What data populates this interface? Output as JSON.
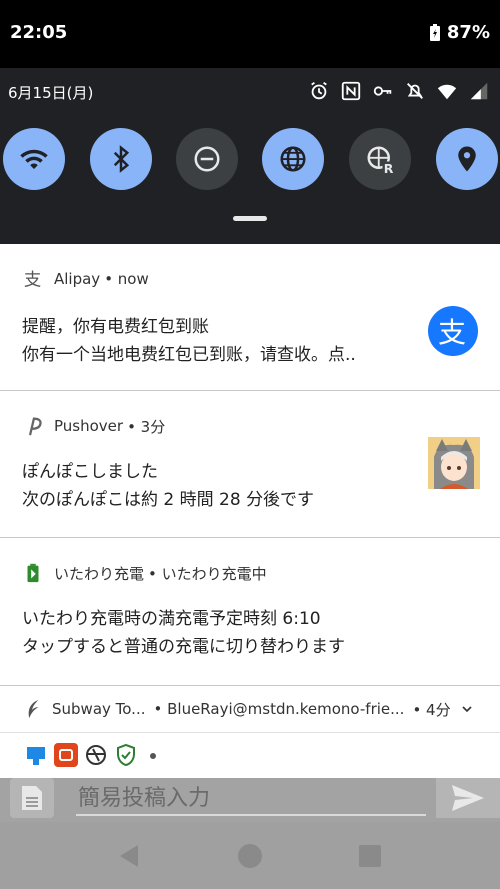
{
  "status": {
    "time": "22:05",
    "battery": "87%"
  },
  "shade": {
    "date": "6月15日(月)",
    "tiles": [
      {
        "name": "wifi",
        "state": "on"
      },
      {
        "name": "bluetooth",
        "state": "on"
      },
      {
        "name": "dnd",
        "state": "off"
      },
      {
        "name": "globe",
        "state": "on"
      },
      {
        "name": "vpn",
        "state": "off"
      },
      {
        "name": "location",
        "state": "on"
      }
    ]
  },
  "notifications": {
    "alipay": {
      "app": "Alipay",
      "time": "• now",
      "title": "提醒，你有电费红包到账",
      "text": "你有一个当地电费红包已到账，请查收。点.."
    },
    "pushover": {
      "app": "Pushover",
      "time": "• 3分",
      "title": "ぽんぽこしました",
      "text": "次のぽんぽこは約 2 時間 28 分後です"
    },
    "charging": {
      "app": "いたわり充電",
      "sub": "• いたわり充電中",
      "title": "いたわり充電時の満充電予定時刻 6:10",
      "text": "タップすると普通の充電に切り替わります"
    },
    "subway": {
      "app": "Subway To...",
      "account": "• BlueRayi@mstdn.kemono-frie...",
      "time": "• 4分"
    }
  },
  "compose": {
    "placeholder": "簡易投稿入力"
  },
  "colors": {
    "tile_on": "#8ab4f8",
    "tile_off": "#3c4043",
    "alipay_blue": "#1677ff"
  }
}
